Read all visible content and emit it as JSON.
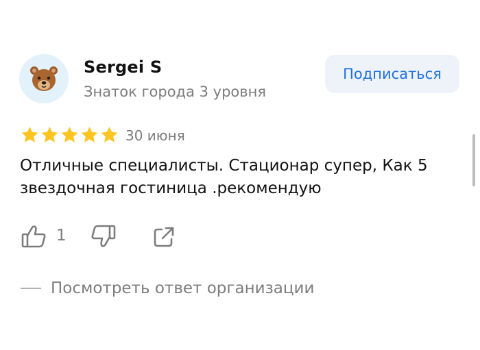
{
  "author": {
    "avatar_icon": "bear-face-icon",
    "name": "Sergei S",
    "level": "Знаток города 3 уровня"
  },
  "subscribe_button": {
    "label": "Подписаться",
    "color": "#1e6fe0"
  },
  "review": {
    "rating": 5,
    "rating_max": 5,
    "star_color": "#fdc522",
    "date": "30 июня",
    "text": "Отличные специалисты. Стационар супер, Как 5 звездочная гостиница .рекомендую"
  },
  "actions": {
    "like_icon": "thumbs-up-icon",
    "like_count": "1",
    "dislike_icon": "thumbs-down-icon",
    "share_icon": "share-icon"
  },
  "org_reply": {
    "label": "Посмотреть ответ организации"
  }
}
